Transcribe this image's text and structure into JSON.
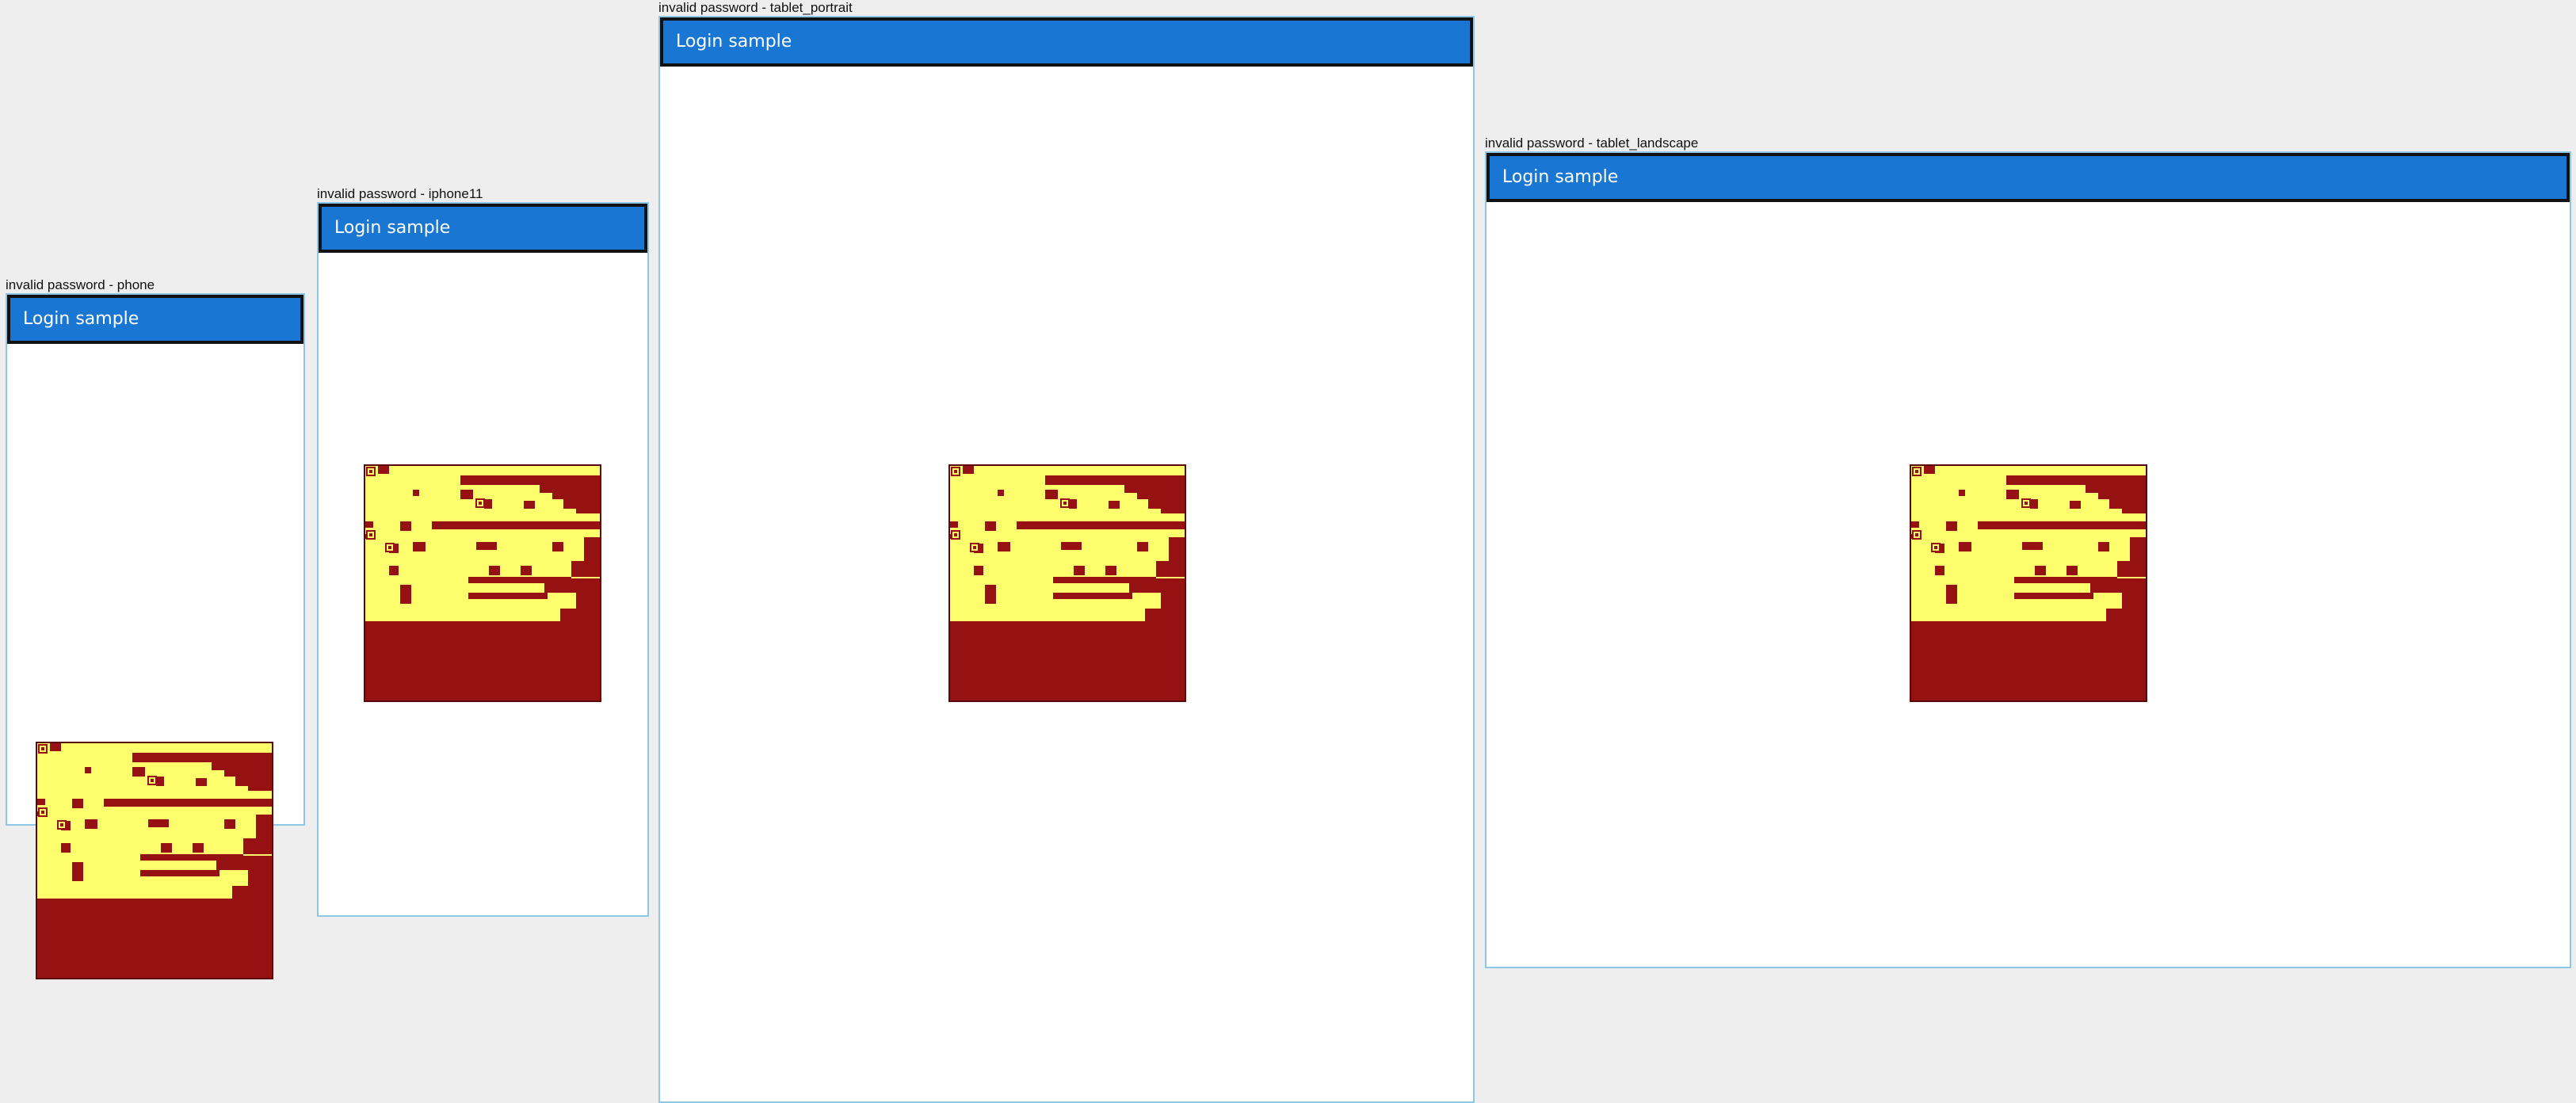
{
  "colors": {
    "canvas_bg": "#eeeeee",
    "screen_bg": "#ffffff",
    "screen_border": "#8ec6e6",
    "appbar_bg": "#1976d2",
    "appbar_border": "#111111",
    "appbar_text": "#ffffff",
    "pattern_fill": "#ffff6e",
    "pattern_bg": "#961111"
  },
  "frames": [
    {
      "title": "invalid password - phone",
      "appbar_title": "Login sample"
    },
    {
      "title": "invalid password - iphone11",
      "appbar_title": "Login sample"
    },
    {
      "title": "invalid password - tablet_portrait",
      "appbar_title": "Login sample"
    },
    {
      "title": "invalid password - tablet_landscape",
      "appbar_title": "Login sample"
    }
  ]
}
